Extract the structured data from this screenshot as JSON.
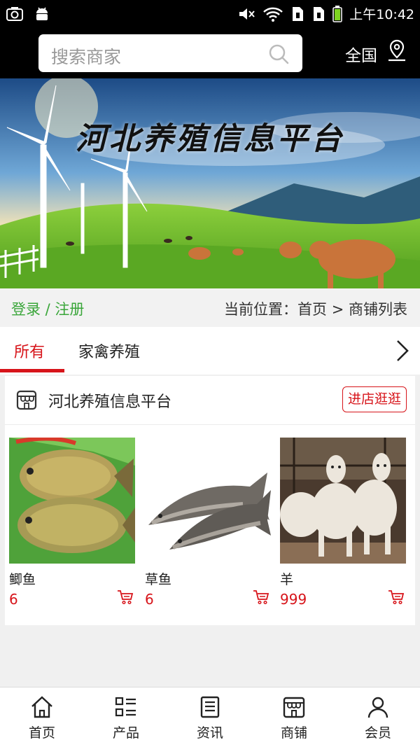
{
  "status_bar": {
    "time": "上午10:42"
  },
  "header": {
    "search_placeholder": "搜索商家",
    "region_label": "全国"
  },
  "banner": {
    "title": "河北养殖信息平台"
  },
  "location_bar": {
    "login_label": "登录 / 注册",
    "breadcrumb": "当前位置：首页 > 商铺列表"
  },
  "tabs": [
    {
      "label": "所有",
      "active": true
    },
    {
      "label": "家禽养殖",
      "active": false
    }
  ],
  "shop": {
    "name": "河北养殖信息平台",
    "enter_button": "进店逛逛",
    "products": [
      {
        "name": "鲫鱼",
        "price": "6",
        "image": "crucian-carp-photo"
      },
      {
        "name": "草鱼",
        "price": "6",
        "image": "grass-carp-photo"
      },
      {
        "name": "羊",
        "price": "999",
        "image": "goats-photo"
      }
    ]
  },
  "bottom_nav": [
    {
      "label": "首页",
      "icon": "home-icon"
    },
    {
      "label": "产品",
      "icon": "list-icon"
    },
    {
      "label": "资讯",
      "icon": "news-icon"
    },
    {
      "label": "商铺",
      "icon": "store-icon"
    },
    {
      "label": "会员",
      "icon": "user-icon"
    }
  ],
  "colors": {
    "accent": "#d7141a",
    "login_green": "#3aa63a",
    "header_bg": "#000000"
  }
}
